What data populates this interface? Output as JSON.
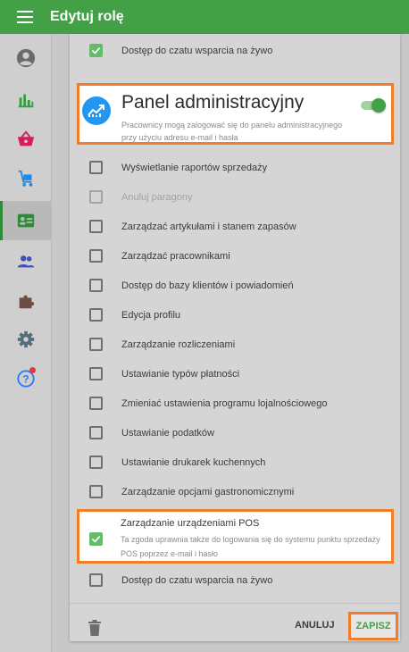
{
  "appbar": {
    "title": "Edytuj rolę",
    "menu_icon": "menu-icon"
  },
  "colors": {
    "primary": "#43a047",
    "highlight": "#ef7d2b",
    "admin_icon": "#2196f3",
    "check": "#66bb6a"
  },
  "sidebar": {
    "items": [
      {
        "icon": "account-circle-icon",
        "active": false
      },
      {
        "icon": "bar-chart-icon",
        "active": false
      },
      {
        "icon": "basket-icon",
        "active": false
      },
      {
        "icon": "cart-icon",
        "active": false
      },
      {
        "icon": "employee-badge-icon",
        "active": true
      },
      {
        "icon": "customers-icon",
        "active": false
      },
      {
        "icon": "puzzle-icon",
        "active": false
      },
      {
        "icon": "settings-icon",
        "active": false
      },
      {
        "icon": "help-icon",
        "active": false,
        "badge": true
      }
    ]
  },
  "permissions": {
    "top_item": {
      "label": "Dostęp do czatu wsparcia na żywo",
      "checked": true
    },
    "admin_panel": {
      "title": "Panel administracyjny",
      "description": "Pracownicy mogą zalogować się do panelu administracyjnego przy użyciu adresu e-mail i hasła",
      "enabled": true
    },
    "items": [
      {
        "label": "Wyświetlanie raportów sprzedaży",
        "checked": false,
        "disabled": false
      },
      {
        "label": "Anuluj paragony",
        "checked": false,
        "disabled": true
      },
      {
        "label": "Zarządzać artykułami i stanem zapasów",
        "checked": false,
        "disabled": false
      },
      {
        "label": "Zarządzać pracownikami",
        "checked": false,
        "disabled": false
      },
      {
        "label": "Dostęp do bazy klientów i powiadomień",
        "checked": false,
        "disabled": false
      },
      {
        "label": "Edycja profilu",
        "checked": false,
        "disabled": false
      },
      {
        "label": "Zarządzanie rozliczeniami",
        "checked": false,
        "disabled": false
      },
      {
        "label": "Ustawianie typów płatności",
        "checked": false,
        "disabled": false
      },
      {
        "label": "Zmieniać ustawienia programu lojalnościowego",
        "checked": false,
        "disabled": false
      },
      {
        "label": "Ustawianie podatków",
        "checked": false,
        "disabled": false
      },
      {
        "label": "Ustawianie drukarek kuchennych",
        "checked": false,
        "disabled": false
      },
      {
        "label": "Zarządzanie opcjami gastronomicznymi",
        "checked": false,
        "disabled": false
      }
    ],
    "pos": {
      "title": "Zarządzanie urządzeniami POS",
      "description": "Ta zgoda uprawnia także do logowania się do systemu punktu sprzedaży POS poprzez e-mail i hasło",
      "checked": true
    },
    "bottom_item": {
      "label": "Dostęp do czatu wsparcia na żywo",
      "checked": false
    }
  },
  "footer": {
    "delete_icon": "trash-icon",
    "cancel_label": "ANULUJ",
    "save_label": "ZAPISZ"
  }
}
